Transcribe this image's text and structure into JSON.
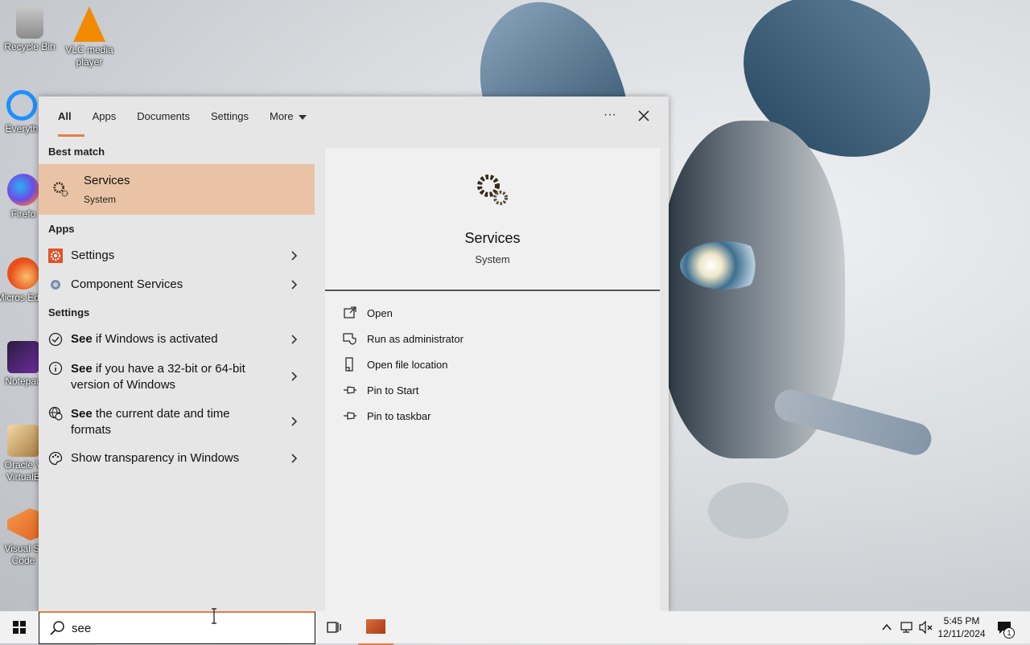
{
  "desktop": {
    "icons": [
      {
        "label": "Recycle Bin",
        "icon": "recycle-bin-icon",
        "color": "#e0e0e0"
      },
      {
        "label": "VLC media player",
        "icon": "vlc-icon",
        "color": "#f28a00"
      },
      {
        "label": "Everyth",
        "icon": "everything-search-icon",
        "color": "#1e90ff"
      },
      {
        "label": "Firefo",
        "icon": "firefox-icon",
        "color": "#ff7139"
      },
      {
        "label": "Micros Edge",
        "icon": "edge-icon",
        "color": "#e94e1b"
      },
      {
        "label": "Notepad",
        "icon": "notepad-icon",
        "color": "#6b2fa0"
      },
      {
        "label": "Oracle V VirtualB",
        "icon": "virtualbox-icon",
        "color": "#a57a3b"
      },
      {
        "label": "Visual St Code",
        "icon": "vscode-icon",
        "color": "#f07c2a"
      }
    ]
  },
  "search_panel": {
    "tabs": [
      {
        "label": "All",
        "active": true
      },
      {
        "label": "Apps"
      },
      {
        "label": "Documents"
      },
      {
        "label": "Settings"
      },
      {
        "label": "More"
      }
    ],
    "more_icon": "ellipsis-icon",
    "close_icon": "close-icon",
    "best_match_heading": "Best match",
    "best_match": {
      "title": "Services",
      "subtitle": "System",
      "icon": "gears-icon"
    },
    "apps_heading": "Apps",
    "apps": [
      {
        "label": "Settings",
        "icon": "settings-gear-icon"
      },
      {
        "label": "Component Services",
        "icon": "component-services-icon"
      }
    ],
    "settings_heading": "Settings",
    "settings": [
      {
        "bold": "See",
        "rest": " if Windows is activated",
        "line2": "",
        "icon": "check-circle-icon"
      },
      {
        "bold": "See",
        "rest": " if you have a 32-bit or 64-bit",
        "line2": "version of Windows",
        "icon": "info-icon"
      },
      {
        "bold": "See",
        "rest": " the current date and time",
        "line2": "formats",
        "icon": "globe-clock-icon"
      },
      {
        "bold": "",
        "rest": "Show transparency in Windows",
        "line2": "",
        "icon": "palette-icon"
      }
    ],
    "preview": {
      "title": "Services",
      "subtitle": "System",
      "actions": [
        {
          "label": "Open",
          "icon": "open-icon"
        },
        {
          "label": "Run as administrator",
          "icon": "shield-icon"
        },
        {
          "label": "Open file location",
          "icon": "file-location-icon"
        },
        {
          "label": "Pin to Start",
          "icon": "pin-icon"
        },
        {
          "label": "Pin to taskbar",
          "icon": "pin-icon"
        }
      ]
    }
  },
  "taskbar": {
    "search_value": "see",
    "clock_time": "5:45 PM",
    "clock_date": "12/11/2024",
    "notification_count": "1"
  },
  "colors": {
    "accent": "#e67e45",
    "highlight": "#eac3a6"
  }
}
